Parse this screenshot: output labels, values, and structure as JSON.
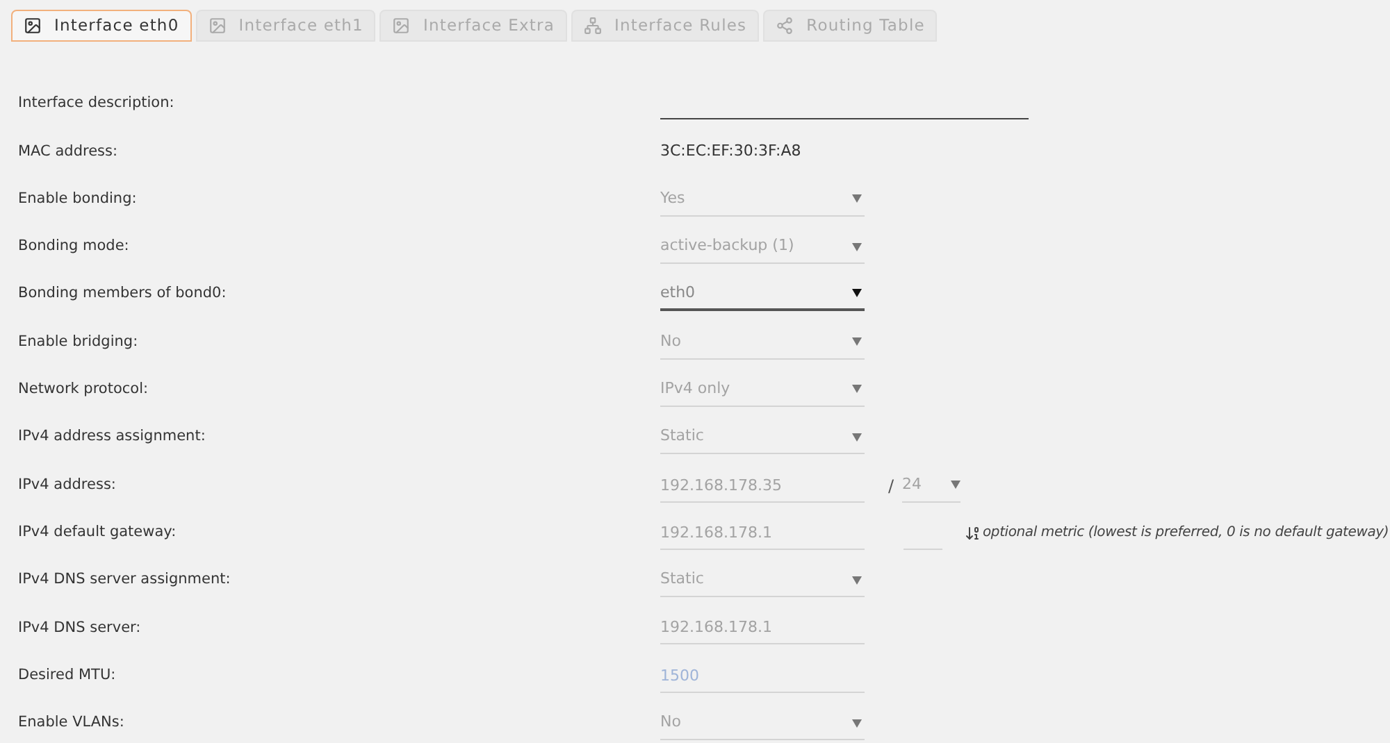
{
  "tabs": [
    {
      "label": "Interface eth0",
      "kind": "screen",
      "selected": true
    },
    {
      "label": "Interface eth1",
      "kind": "screen",
      "selected": false
    },
    {
      "label": "Interface Extra",
      "kind": "screen",
      "selected": false
    },
    {
      "label": "Interface Rules",
      "kind": "tree",
      "selected": false
    },
    {
      "label": "Routing Table",
      "kind": "share",
      "selected": false
    }
  ],
  "rows": [
    {
      "label": "Interface description:",
      "kind": "wide-input"
    },
    {
      "label": "MAC address:",
      "kind": "static",
      "value": "3C:EC:EF:30:3F:A8"
    },
    {
      "label": "Enable bonding:",
      "kind": "select",
      "value": "Yes",
      "focused": false
    },
    {
      "label": "Bonding mode:",
      "kind": "select",
      "value": "active-backup (1)",
      "focused": false
    },
    {
      "label": "Bonding members of bond0:",
      "kind": "select",
      "value": "eth0",
      "focused": true
    },
    {
      "label": "Enable bridging:",
      "kind": "select",
      "value": "No",
      "focused": false
    },
    {
      "label": "Network protocol:",
      "kind": "select",
      "value": "IPv4 only",
      "focused": false
    },
    {
      "label": "IPv4 address assignment:",
      "kind": "select",
      "value": "Static",
      "focused": false
    },
    {
      "label": "IPv4 address:",
      "kind": "ip-prefix",
      "value": "192.168.178.35",
      "separator": "/",
      "prefix": "24"
    },
    {
      "label": "IPv4 default gateway:",
      "kind": "gateway",
      "value": "192.168.178.1",
      "hint": "optional metric (lowest is preferred, 0 is no default gateway)"
    },
    {
      "label": "IPv4 DNS server assignment:",
      "kind": "select",
      "value": "Static",
      "focused": false
    },
    {
      "label": "IPv4 DNS server:",
      "kind": "input",
      "value": "192.168.178.1"
    },
    {
      "label": "Desired MTU:",
      "kind": "input",
      "placeholder": "1500"
    },
    {
      "label": "Enable VLANs:",
      "kind": "select",
      "value": "No",
      "focused": false
    }
  ]
}
